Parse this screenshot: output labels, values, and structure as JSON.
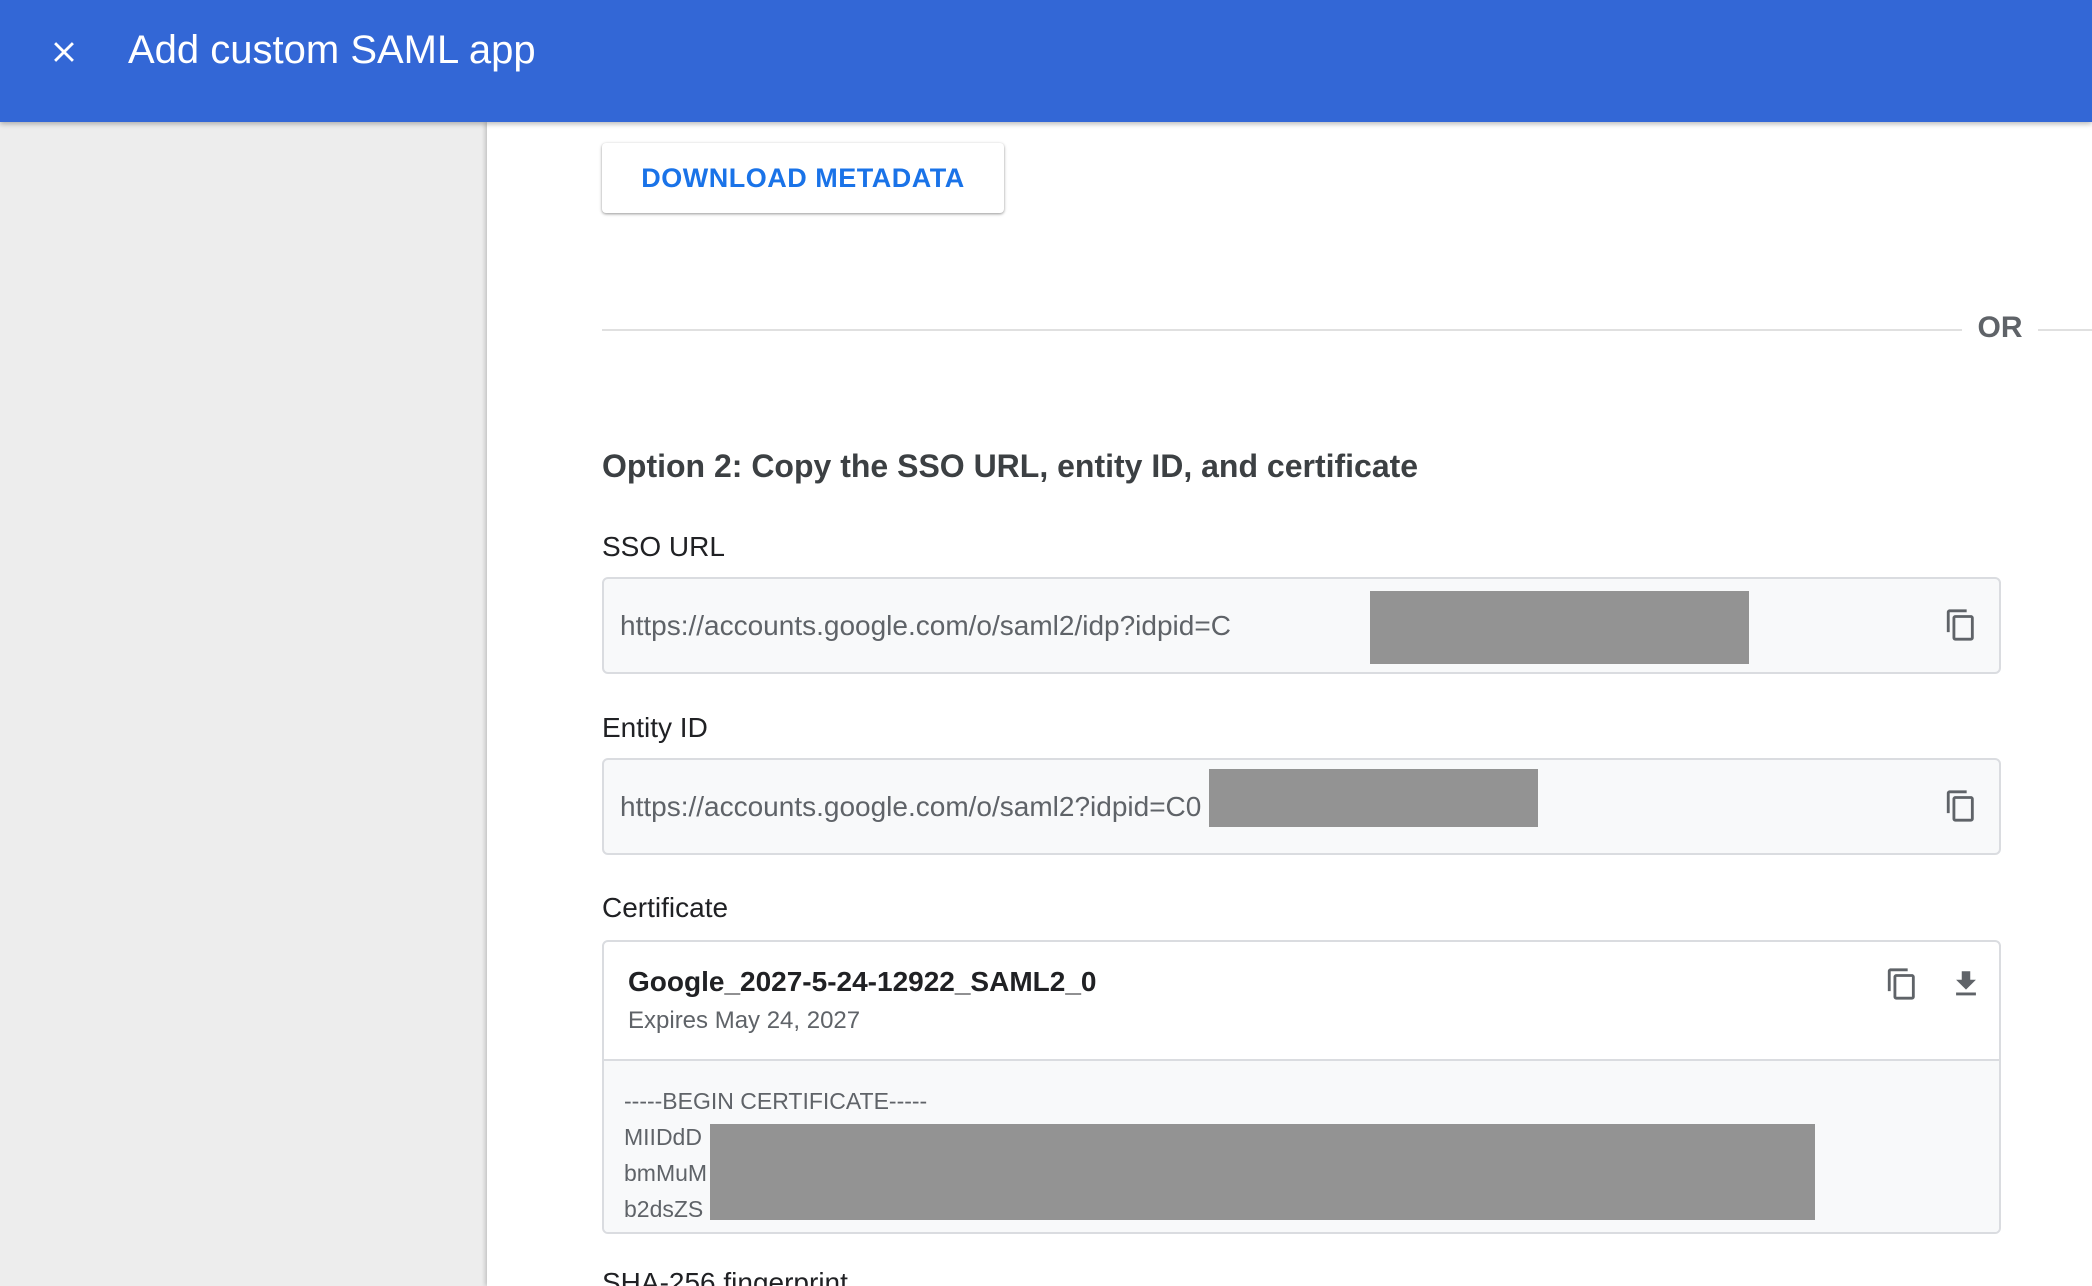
{
  "header": {
    "title": "Add custom SAML app",
    "background_color": "#3367d6",
    "close_icon": "close-icon"
  },
  "main": {
    "download_metadata_label": "DOWNLOAD METADATA",
    "or_label": "OR",
    "option2_heading": "Option 2: Copy the SSO URL, entity ID, and certificate",
    "sso_url": {
      "label": "SSO URL",
      "value": "https://accounts.google.com/o/saml2/idp?idpid=C",
      "icon": "copy-icon"
    },
    "entity_id": {
      "label": "Entity ID",
      "value": "https://accounts.google.com/o/saml2?idpid=C0",
      "icon": "copy-icon"
    },
    "certificate": {
      "label": "Certificate",
      "name": "Google_2027-5-24-12922_SAML2_0",
      "expires": "Expires May 24, 2027",
      "lines": [
        "-----BEGIN CERTIFICATE-----",
        "MIIDdD",
        "bmMuM",
        "b2dsZS"
      ],
      "icons": [
        "copy-icon",
        "download-icon"
      ]
    },
    "sha256_label": "SHA-256 fingerprint"
  },
  "colors": {
    "accent": "#1a73e8",
    "redaction": "#939393",
    "sidebar_bg": "#ededed"
  }
}
